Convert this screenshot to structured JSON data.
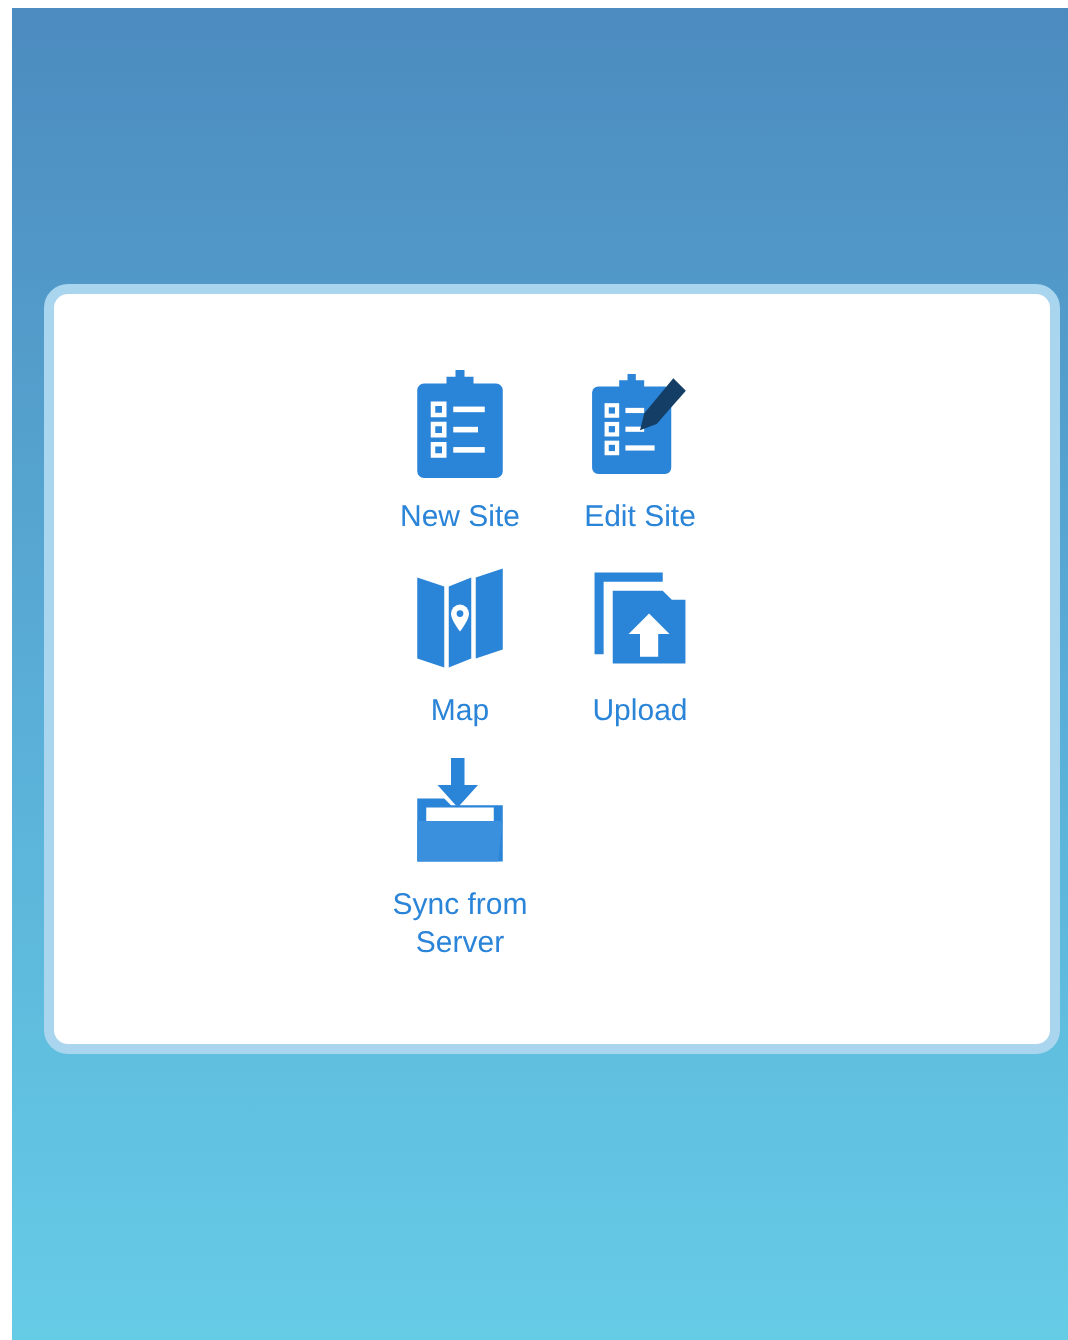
{
  "menu": [
    {
      "kind": "new",
      "label": "New Site"
    },
    {
      "kind": "edit",
      "label": "Edit Site"
    },
    {
      "kind": "map",
      "label": "Map"
    },
    {
      "kind": "upload",
      "label": "Upload"
    },
    {
      "kind": "sync",
      "label": "Sync from Server"
    }
  ]
}
